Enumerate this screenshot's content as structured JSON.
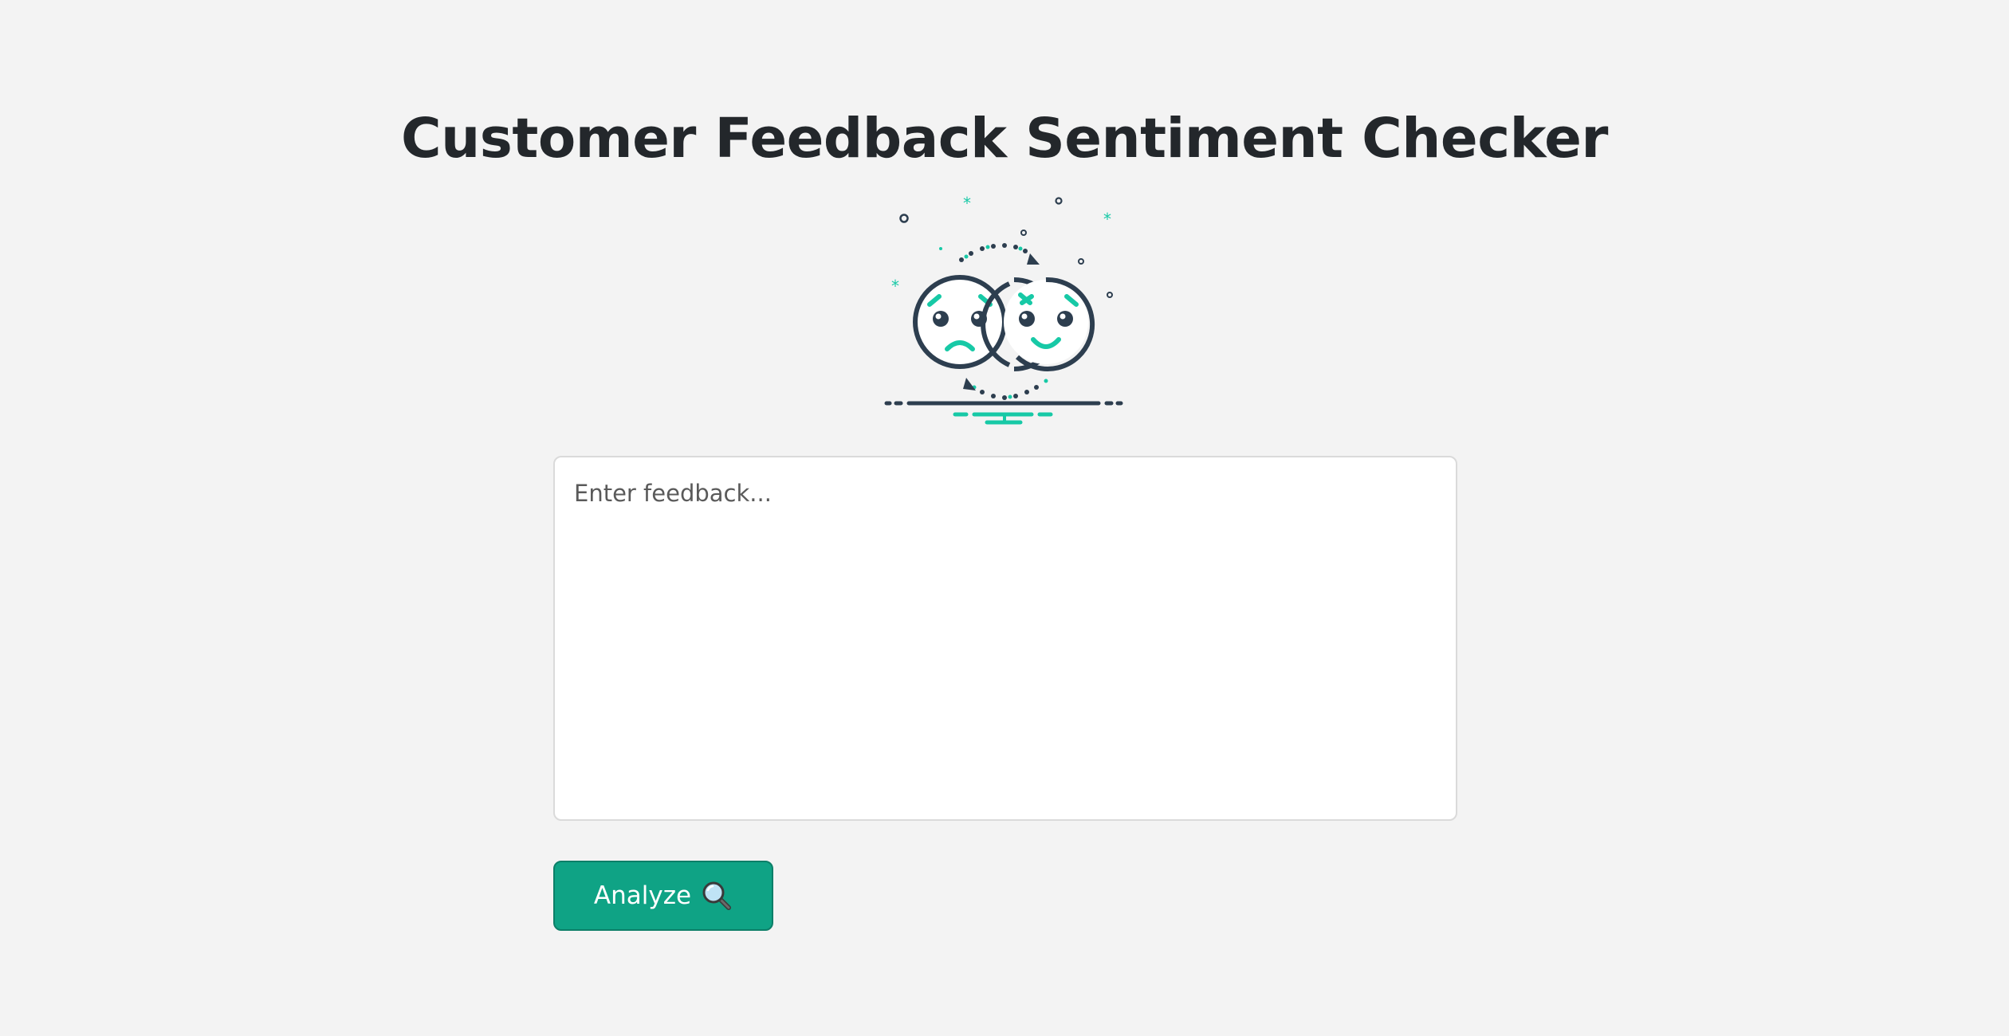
{
  "page": {
    "title": "Customer Feedback Sentiment Checker"
  },
  "illustration": {
    "icon": "sad-to-happy-faces-icon"
  },
  "feedback": {
    "placeholder": "Enter feedback...",
    "value": ""
  },
  "analyze": {
    "label": "Analyze",
    "icon": "magnifying-glass-icon"
  },
  "colors": {
    "background": "#f3f3f3",
    "accent": "#0fa385",
    "accent_teal": "#17c9a6",
    "dark": "#2d3e4f",
    "title": "#23272b"
  }
}
